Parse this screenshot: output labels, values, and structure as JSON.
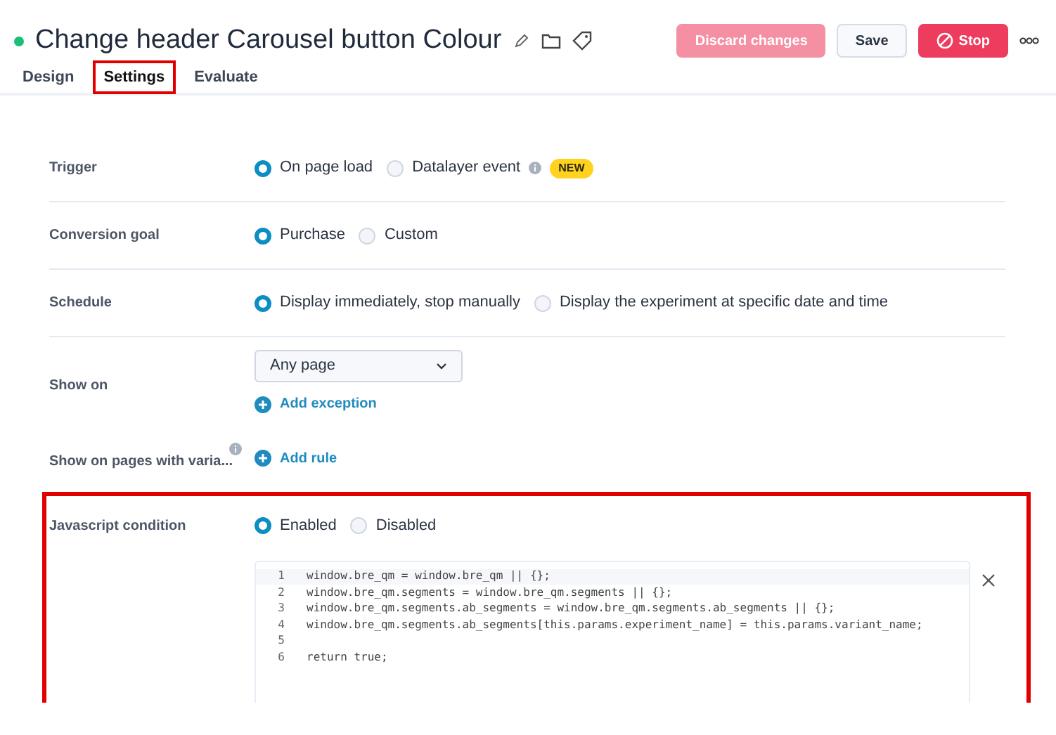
{
  "header": {
    "status_active": true,
    "title": "Change header Carousel button Colour",
    "buttons": [
      {
        "label": "Discard changes",
        "kind": "discard"
      },
      {
        "label": "Save",
        "kind": "save"
      },
      {
        "label": "Stop",
        "kind": "stop"
      }
    ]
  },
  "tabs": [
    {
      "label": "Design",
      "selected": false,
      "highlighted": false
    },
    {
      "label": "Settings",
      "selected": true,
      "highlighted": true
    },
    {
      "label": "Evaluate",
      "selected": false,
      "highlighted": false
    }
  ],
  "settings": [
    {
      "kind": "radio",
      "label": "Trigger",
      "highlighted": false,
      "options": [
        {
          "label": "On page load",
          "selected": true
        },
        {
          "label": "Datalayer event",
          "selected": false,
          "info": true,
          "badge": "NEW"
        }
      ]
    },
    {
      "kind": "radio",
      "label": "Conversion goal",
      "highlighted": false,
      "options": [
        {
          "label": "Purchase",
          "selected": true
        },
        {
          "label": "Custom",
          "selected": false
        }
      ]
    },
    {
      "kind": "radio",
      "label": "Schedule",
      "highlighted": false,
      "options": [
        {
          "label": "Display immediately, stop manually",
          "selected": true
        },
        {
          "label": "Display the experiment at specific date and time",
          "selected": false
        }
      ]
    },
    {
      "kind": "select",
      "label": "Show on",
      "highlighted": false,
      "value": "Any page",
      "action": "Add exception"
    },
    {
      "kind": "rule",
      "label": "Show on pages with varia...",
      "info": true,
      "highlighted": false,
      "action": "Add rule"
    },
    {
      "kind": "code",
      "label": "Javascript condition",
      "highlighted": true,
      "options": [
        {
          "label": "Enabled",
          "selected": true
        },
        {
          "label": "Disabled",
          "selected": false
        }
      ],
      "code": [
        {
          "number": "1",
          "text": "window.bre_qm = window.bre_qm || {};"
        },
        {
          "number": "2",
          "text": "window.bre_qm.segments = window.bre_qm.segments || {};"
        },
        {
          "number": "3",
          "text": "window.bre_qm.segments.ab_segments = window.bre_qm.segments.ab_segments || {};"
        },
        {
          "number": "4",
          "text": "window.bre_qm.segments.ab_segments[this.params.experiment_name] = this.params.variant_name;"
        },
        {
          "number": "5"
        },
        {
          "number": "6",
          "text": "return true;"
        }
      ]
    }
  ]
}
